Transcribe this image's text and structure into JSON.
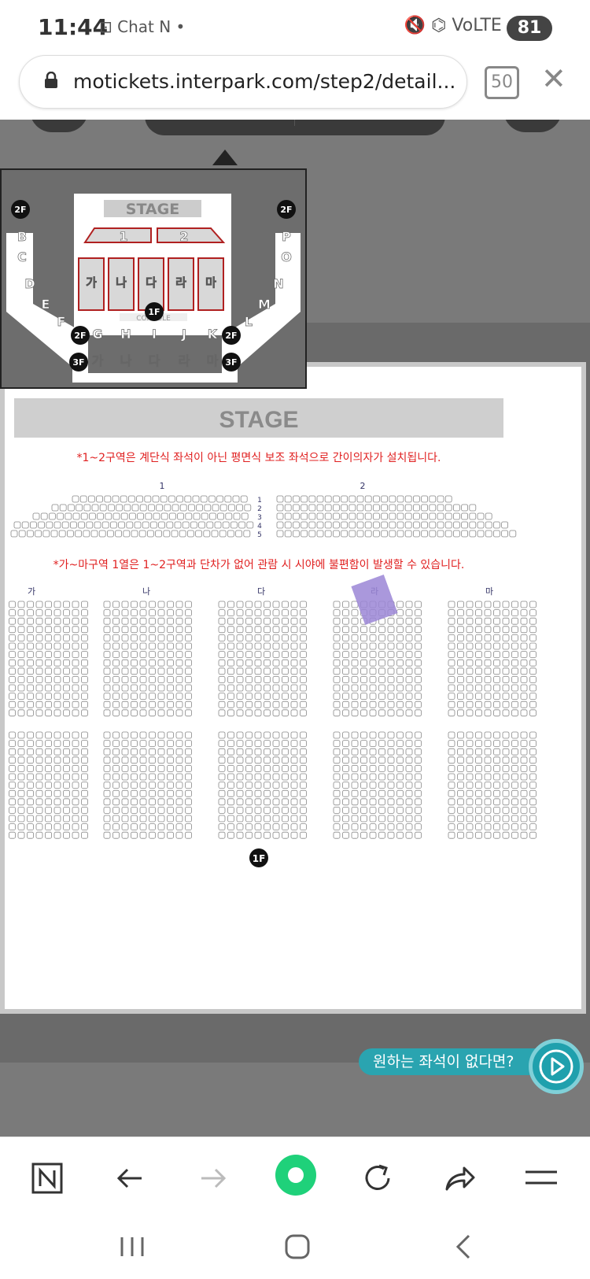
{
  "status": {
    "time": "11:44",
    "left_icons": "⊡ Chat N •",
    "right_icons": "🔇 ⌬ VoLTE .ıl",
    "battery": "81"
  },
  "browser": {
    "url": "motickets.interpark.com/step2/detail...",
    "tab_count": "50"
  },
  "minimap": {
    "stage": "STAGE",
    "floor_markers": [
      "2F",
      "2F",
      "1F",
      "2F",
      "2F",
      "3F",
      "3F"
    ],
    "left_blocks": [
      "B",
      "C",
      "D",
      "E",
      "F"
    ],
    "right_blocks": [
      "P",
      "O",
      "N",
      "M",
      "L"
    ],
    "front_blocks": [
      "1",
      "2"
    ],
    "main_blocks": [
      "가",
      "나",
      "다",
      "라",
      "마"
    ],
    "console": "CONSOLE",
    "second_floor_blocks": [
      "G",
      "H",
      "I",
      "J",
      "K"
    ],
    "third_floor_blocks": [
      "가",
      "나",
      "다",
      "라",
      "마"
    ]
  },
  "seatmap": {
    "stage": "STAGE",
    "notice1": "*1~2구역은 계단식 좌석이 아닌 평면식 보조 좌석으로 간이의자가 설치됩니다.",
    "notice2": "*가~마구역 1열은 1~2구역과 단차가 없어 관람 시 시야에 불편함이 발생할 수 있습니다.",
    "front_sections": [
      "1",
      "2"
    ],
    "row_labels": [
      "1",
      "2",
      "3",
      "4",
      "5"
    ],
    "main_sections": [
      "가",
      "나",
      "다",
      "라",
      "마"
    ],
    "floor": "1F",
    "highlight_section": "라"
  },
  "cta": {
    "label": "원하는 좌석이 없다면?"
  },
  "colors": {
    "accent": "#2aa4b0",
    "notice": "#e02020",
    "highlight": "#9b86d6",
    "record": "#1fd17a"
  }
}
